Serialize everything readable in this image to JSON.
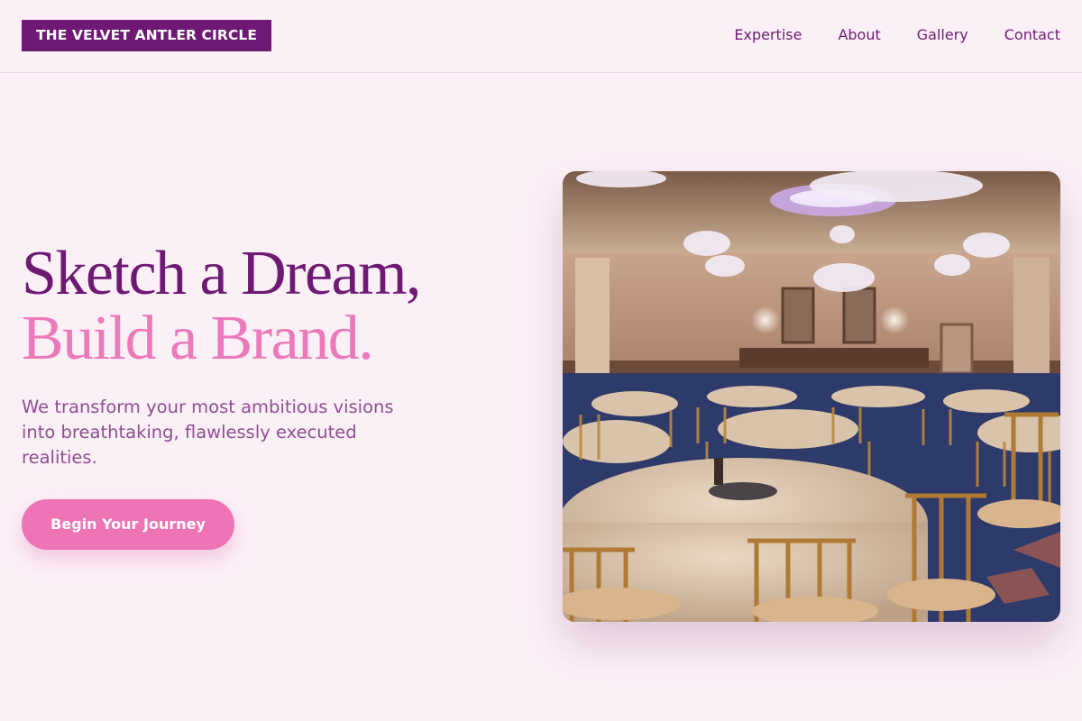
{
  "header": {
    "logo": "THE VELVET ANTLER CIRCLE",
    "nav": [
      "Expertise",
      "About",
      "Gallery",
      "Contact"
    ]
  },
  "hero": {
    "title_line1": "Sketch a Dream,",
    "title_line2": "Build a Brand.",
    "subtitle": "We transform your most ambitious visions into breathtaking, flawlessly executed realities.",
    "cta_label": "Begin Your Journey"
  },
  "colors": {
    "brand_purple": "#6e1a74",
    "accent_pink": "#ee74b6",
    "background": "#fcf0f7"
  }
}
